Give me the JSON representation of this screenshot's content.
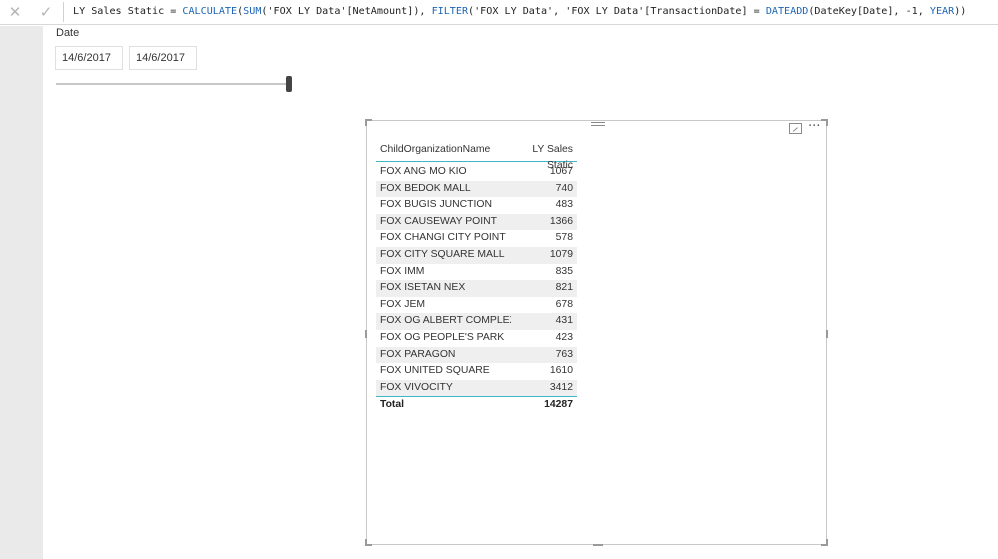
{
  "formula_bar": {
    "cancel_icon": "close-icon",
    "commit_icon": "check-icon",
    "segments": [
      {
        "text": "LY Sales Static = ",
        "kind": "plain"
      },
      {
        "text": "CALCULATE",
        "kind": "fn"
      },
      {
        "text": "(",
        "kind": "plain"
      },
      {
        "text": "SUM",
        "kind": "fn"
      },
      {
        "text": "('FOX LY Data'[NetAmount]), ",
        "kind": "plain"
      },
      {
        "text": "FILTER",
        "kind": "fn"
      },
      {
        "text": "('FOX LY Data', 'FOX LY Data'[TransactionDate] = ",
        "kind": "plain"
      },
      {
        "text": "DATEADD",
        "kind": "fn"
      },
      {
        "text": "(DateKey[Date], -1, ",
        "kind": "plain"
      },
      {
        "text": "YEAR",
        "kind": "fn"
      },
      {
        "text": "))",
        "kind": "plain"
      }
    ]
  },
  "slicer": {
    "title": "Date",
    "from_date": "14/6/2017",
    "to_date": "14/6/2017",
    "slider_position": 1.0
  },
  "visual": {
    "focus_mode_icon": "focus-mode-icon",
    "more_options_icon": "more-options-icon",
    "table": {
      "headers": [
        "ChildOrganizationName",
        "LY Sales Static"
      ],
      "rows": [
        [
          "FOX ANG MO KIO",
          "1067"
        ],
        [
          "FOX BEDOK MALL",
          "740"
        ],
        [
          "FOX BUGIS JUNCTION",
          "483"
        ],
        [
          "FOX CAUSEWAY POINT",
          "1366"
        ],
        [
          "FOX CHANGI CITY POINT",
          "578"
        ],
        [
          "FOX CITY SQUARE MALL",
          "1079"
        ],
        [
          "FOX IMM",
          "835"
        ],
        [
          "FOX ISETAN NEX",
          "821"
        ],
        [
          "FOX JEM",
          "678"
        ],
        [
          "FOX OG ALBERT COMPLEX",
          "431"
        ],
        [
          "FOX OG PEOPLE'S PARK",
          "423"
        ],
        [
          "FOX PARAGON",
          "763"
        ],
        [
          "FOX UNITED SQUARE",
          "1610"
        ],
        [
          "FOX VIVOCITY",
          "3412"
        ]
      ],
      "total_label": "Total",
      "total_value": "14287"
    }
  },
  "colors": {
    "function_blue": "#1c64b5",
    "table_accent": "#41b6c4",
    "gutter": "#eaeaea"
  }
}
